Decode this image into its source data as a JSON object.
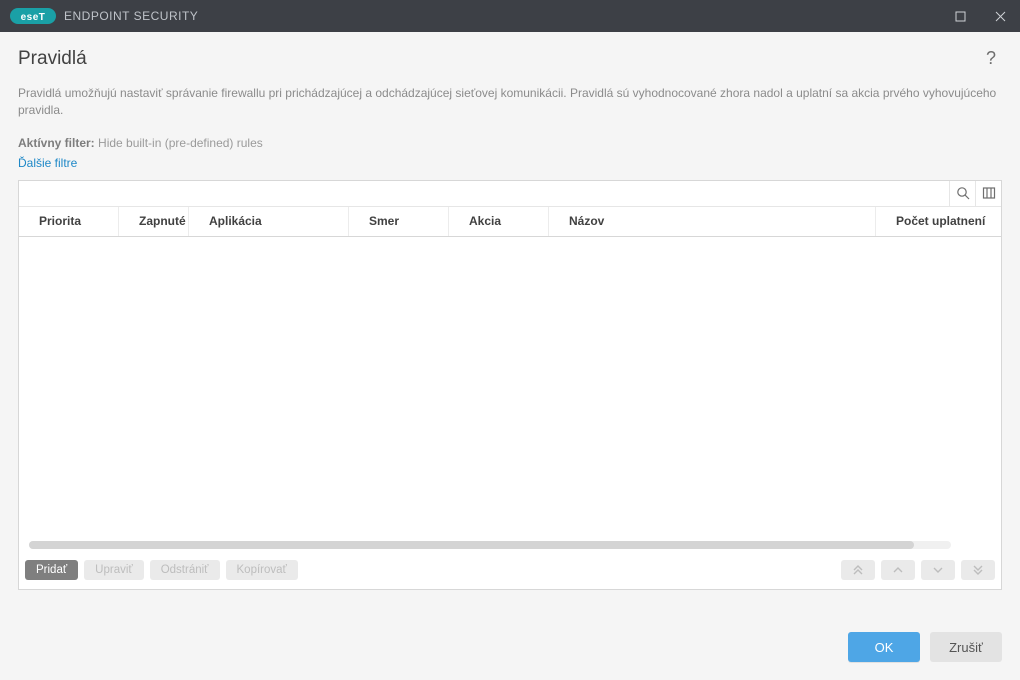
{
  "titlebar": {
    "product": "ENDPOINT SECURITY"
  },
  "header": {
    "title": "Pravidlá"
  },
  "description": "Pravidlá umožňujú nastaviť správanie firewallu pri prichádzajúcej a odchádzajúcej sieťovej komunikácii. Pravidlá sú vyhodnocované zhora nadol a uplatní sa akcia prvého vyhovujúceho pravidla.",
  "filter": {
    "label": "Aktívny filter:",
    "value": "Hide built-in (pre-defined) rules",
    "more": "Ďalšie filtre"
  },
  "columns": {
    "priorita": "Priorita",
    "zapnute": "Zapnuté",
    "aplikacia": "Aplikácia",
    "smer": "Smer",
    "akcia": "Akcia",
    "nazov": "Názov",
    "pocet": "Počet uplatnení"
  },
  "rows": [],
  "actions": {
    "add": "Pridať",
    "edit": "Upraviť",
    "delete": "Odstrániť",
    "copy": "Kopírovať"
  },
  "footer": {
    "ok": "OK",
    "cancel": "Zrušiť"
  }
}
